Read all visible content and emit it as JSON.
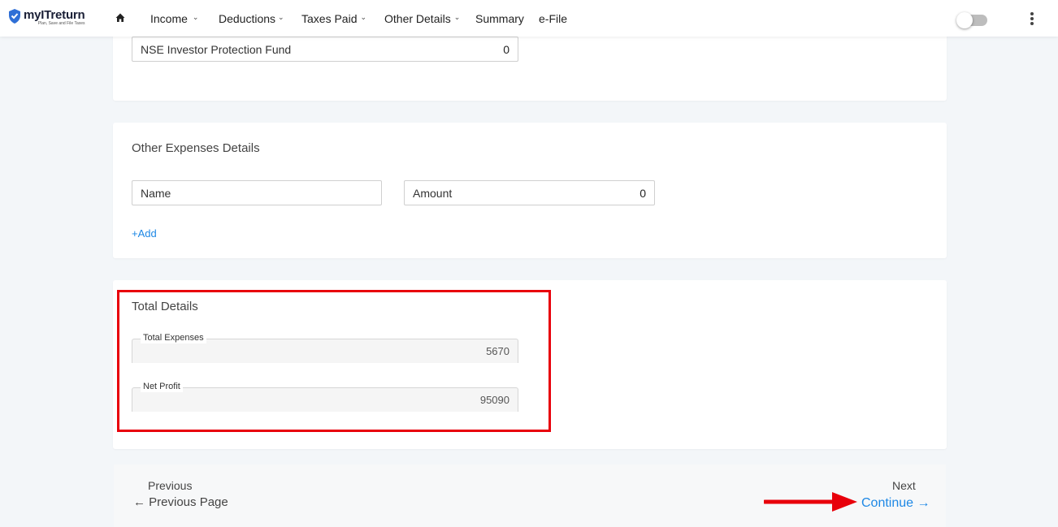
{
  "header": {
    "logo": {
      "name": "myITreturn",
      "tagline": "Plan, Save and File Taxes"
    },
    "nav": [
      {
        "label": "Income",
        "dropdown": true
      },
      {
        "label": "Deductions",
        "dropdown": true
      },
      {
        "label": "Taxes Paid",
        "dropdown": true
      },
      {
        "label": "Other Details",
        "dropdown": true
      },
      {
        "label": "Summary",
        "dropdown": false
      },
      {
        "label": "e-File",
        "dropdown": false
      }
    ],
    "chevron": "⌄",
    "toggle_state": "off"
  },
  "top_card": {
    "field": {
      "label": "NSE Investor Protection Fund",
      "value": "0"
    }
  },
  "other_expenses": {
    "title": "Other Expenses Details",
    "name_placeholder": "Name",
    "amount_label": "Amount",
    "amount_value": "0",
    "add_label": "+Add"
  },
  "total_details": {
    "title": "Total Details",
    "total_expenses": {
      "label": "Total Expenses",
      "value": "5670"
    },
    "net_profit": {
      "label": "Net Profit",
      "value": "95090"
    }
  },
  "footer": {
    "previous_caption": "Previous",
    "previous_link": "← Previous Page",
    "next_caption": "Next",
    "continue_link": "Continue →"
  },
  "colors": {
    "accent": "#1e88e5",
    "highlight": "#e8000b",
    "background": "#f3f6f9"
  }
}
